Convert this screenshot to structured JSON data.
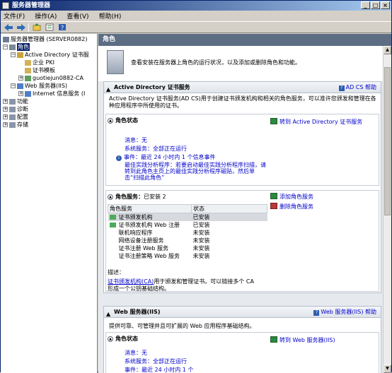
{
  "window": {
    "title": "服务器管理器",
    "buttons": [
      "_",
      "□",
      "×"
    ]
  },
  "menu": [
    "文件(F)",
    "操作(A)",
    "查看(V)",
    "帮助(H)"
  ],
  "toolbar": {
    "icons": [
      "back-icon",
      "forward-icon",
      "up-icon",
      "refresh-icon",
      "help-icon"
    ]
  },
  "tree": {
    "root": "服务器管理器 (SERVER0882)",
    "roles": "角色",
    "adcs": "Active Directory 证书服",
    "enterprise_pki": "企业 PKI",
    "cert_templates": "证书模板",
    "ca_node": "guotiejun0882-CA",
    "web_server": "Web 服务器(IIS)",
    "iis_manager": "Internet 信息服务 (I",
    "features": "功能",
    "diagnostics": "诊断",
    "configuration": "配置",
    "storage": "存储"
  },
  "main": {
    "header": "角色",
    "intro": "查看安装在服务器上角色的运行状况，以及添加或删除角色和功能。"
  },
  "adcs_section": {
    "title": "Active Directory 证书服务",
    "help": "AD CS 帮助",
    "desc": "Active Directory 证书服务(AD CS)用于创建证书颁发机构和相关的角色服务，可以准许您颁发和管理在各种应用程序中所使用的证书。",
    "status_title": "角色状态",
    "goto": "转到 Active Directory 证书服务",
    "messages_label": "消息：",
    "messages_value": "无",
    "sysservices_label": "系统服务：",
    "sysservices_value": "全部正在运行",
    "events_label": "事件：",
    "events_value": "最近 24 小时内 1 个信息事件",
    "bpa_label": "最佳实践分析程序：",
    "bpa_text": "若要启动最佳实践分析程序扫描，请转到此角色主页上的最佳实践分析程序磁贴，然后单击“扫描此角色”",
    "services_title": "角色服务：",
    "services_installed": "已安装 2",
    "add_services": "添加角色服务",
    "remove_services": "删除角色服务",
    "table_headers": [
      "角色服务",
      "状态"
    ],
    "services": [
      {
        "name": "证书颁发机构",
        "status": "已安装"
      },
      {
        "name": "证书颁发机构 Web 注册",
        "status": "已安装"
      },
      {
        "name": "联机响应程序",
        "status": "未安装"
      },
      {
        "name": "网络设备注册服务",
        "status": "未安装"
      },
      {
        "name": "证书注册 Web 服务",
        "status": "未安装"
      },
      {
        "name": "证书注册策略 Web 服务",
        "status": "未安装"
      }
    ],
    "desc_label": "描述：",
    "desc_link": "证书颁发机构(CA)",
    "desc_rest1": "用于颁发和管理证书。可以链接多个 CA",
    "desc_rest2": "形成一个公钥基础结构。"
  },
  "web_section": {
    "title": "Web 服务器(IIS)",
    "help": "Web 服务器(IIS) 帮助",
    "desc": "提供可靠、可管理并且可扩展的 Web 应用程序基础结构。",
    "status_title": "角色状态",
    "goto": "转到 Web 服务器(IIS)",
    "messages_label": "消息：",
    "messages_value": "无",
    "sysservices_label": "系统服务：",
    "sysservices_value": "全部正在运行",
    "events_label": "事件：",
    "events_value": "最近 24 小时内 1 个"
  }
}
